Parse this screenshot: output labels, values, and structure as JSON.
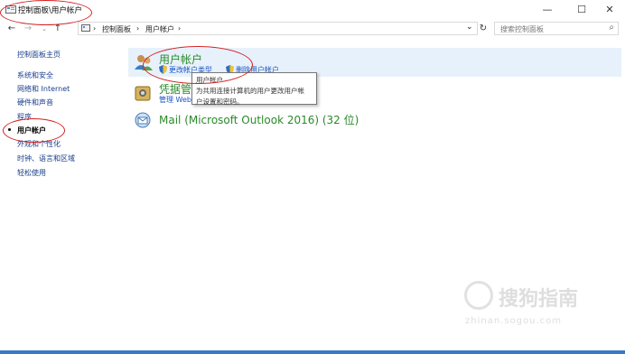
{
  "window": {
    "title": "控制面板\\用户帐户",
    "minimize_glyph": "—",
    "maximize_glyph": "☐",
    "close_glyph": "✕"
  },
  "nav": {
    "back_glyph": "←",
    "forward_glyph": "→",
    "up_glyph": "↑",
    "breadcrumb": [
      "控制面板",
      "用户帐户"
    ],
    "separator": "›",
    "dropdown_glyph": "⌄",
    "refresh_glyph": "↻",
    "search_placeholder": "搜索控制面板",
    "search_glyph": "⌕"
  },
  "sidebar": {
    "items": [
      {
        "label": "控制面板主页"
      },
      {
        "label": "系统和安全"
      },
      {
        "label": "网络和 Internet"
      },
      {
        "label": "硬件和声音"
      },
      {
        "label": "程序"
      },
      {
        "label": "用户帐户",
        "current": true
      },
      {
        "label": "外观和个性化"
      },
      {
        "label": "时钟、语言和区域"
      },
      {
        "label": "轻松使用"
      }
    ]
  },
  "categories": {
    "user_accounts": {
      "title": "用户帐户",
      "links": [
        "更改帐户类型",
        "删除用户帐户"
      ]
    },
    "credential_manager": {
      "title": "凭据管",
      "link": "管理 Web"
    },
    "mail": {
      "title": "Mail (Microsoft Outlook 2016) (32 位)"
    }
  },
  "tooltip": {
    "line1": "用户帐户",
    "line2": "为共用连接计算机的用户更改用户帐",
    "line3": "户设置和密码。"
  },
  "watermark": {
    "text": "搜狗指南",
    "url": "zhinan.sogou.com"
  },
  "colors": {
    "link_blue": "#1a3e8c",
    "category_green": "#2a8a2a",
    "annotation_red": "#d42020",
    "highlight_bg": "#e7f1fb"
  }
}
